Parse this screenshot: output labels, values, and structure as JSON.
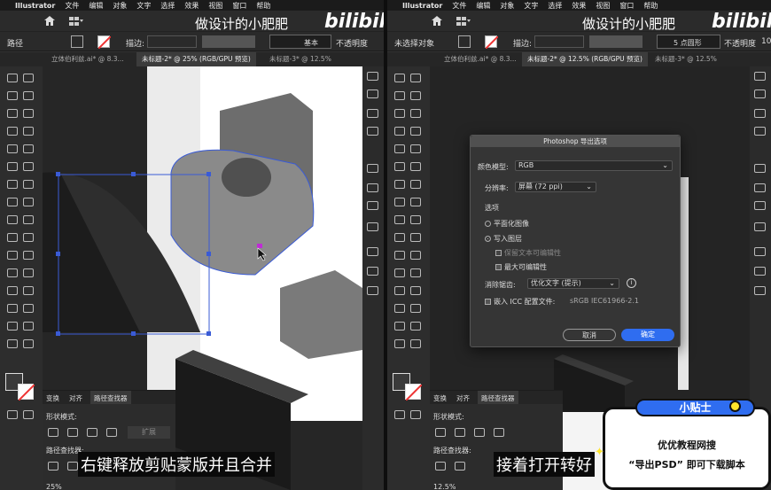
{
  "menubar": {
    "apple": "",
    "app": "Illustrator",
    "items": [
      "文件",
      "编辑",
      "对象",
      "文字",
      "选择",
      "效果",
      "视图",
      "窗口",
      "帮助"
    ]
  },
  "watermark": {
    "text": "做设计的小肥肥",
    "logo": "bilibili"
  },
  "left": {
    "control": {
      "label": "路径",
      "stroke_label": "描边:",
      "preset": "基本",
      "opacity": "不透明度"
    },
    "tabs": [
      "立体伯利兹.ai* @ 8.3...",
      "未标题-2* @ 25% (RGB/GPU 预览)",
      "未标题-3* @ 12.5%"
    ],
    "panel": {
      "tabs": [
        "变换",
        "对齐",
        "路径查找器"
      ],
      "shape_modes": "形状模式:",
      "expand": "扩展",
      "pathfinder": "路径查找器:"
    },
    "zoom": "25%",
    "subtitle": "右键释放剪贴蒙版并且合并"
  },
  "right": {
    "control": {
      "label": "未选择对象",
      "stroke_label": "描边:",
      "preset": "5 点圆形",
      "opacity": "不透明度",
      "opacity_value": "10"
    },
    "tabs": [
      "立体伯利兹.ai* @ 8.3...",
      "未标题-2* @ 12.5% (RGB/GPU 预览)",
      "未标题-3* @ 12.5%"
    ],
    "panel": {
      "tabs": [
        "变换",
        "对齐",
        "路径查找器"
      ],
      "shape_modes": "形状模式:",
      "pathfinder": "路径查找器:"
    },
    "zoom": "12.5%",
    "subtitle": "接着打开转好",
    "dialog": {
      "title": "Photoshop 导出选项",
      "color_model_label": "颜色模型:",
      "color_model": "RGB",
      "resolution_label": "分辨率:",
      "resolution": "屏幕 (72 ppi)",
      "options_label": "选项",
      "flat_image": "平面化图像",
      "write_layers": "写入图层",
      "keep_text": "保留文本可编辑性",
      "max_edit": "最大可编辑性",
      "aa_label": "消除锯齿:",
      "aa_value": "优化文字 (提示)",
      "icc": "嵌入 ICC 配置文件:",
      "icc_value": "sRGB IEC61966-2.1",
      "cancel": "取消",
      "ok": "确定"
    },
    "tip": {
      "head": "小贴士",
      "line1": "优优教程网搜",
      "line2": "“导出PSD” 即可下载脚本"
    }
  },
  "colors": {
    "accent": "#2f6df0",
    "ui_bg": "#323232",
    "selection": "#3a5bd6"
  }
}
